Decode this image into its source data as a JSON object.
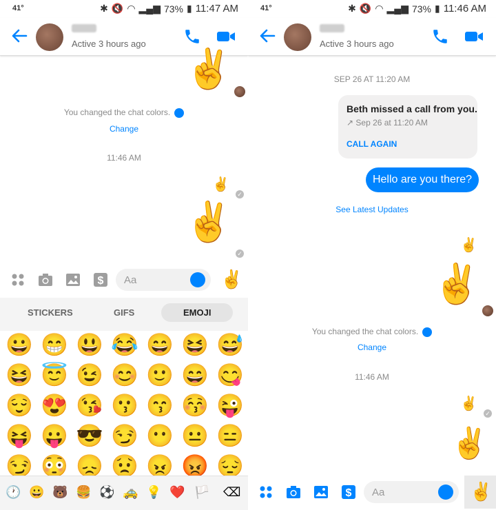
{
  "left": {
    "status": {
      "indicator": "41°",
      "battery": "73%",
      "time": "11:47 AM"
    },
    "header": {
      "active": "Active 3 hours ago"
    },
    "notice": "You changed the chat colors.",
    "change_link": "Change",
    "timestamp": "11:46 AM",
    "composer": {
      "placeholder": "Aa"
    },
    "tabs": [
      "STICKERS",
      "GIFS",
      "EMOJI"
    ],
    "emoji_rows": [
      [
        "😀",
        "😁",
        "😃",
        "😂",
        "😄",
        "😆",
        "😅"
      ],
      [
        "😆",
        "😇",
        "😉",
        "😊",
        "🙂",
        "😄",
        "😋"
      ],
      [
        "😌",
        "😍",
        "😘",
        "😗",
        "😙",
        "😚",
        "😜"
      ],
      [
        "😝",
        "😛",
        "😎",
        "😏",
        "😶",
        "😐",
        "😑"
      ],
      [
        "😏",
        "😳",
        "😞",
        "😟",
        "😠",
        "😡",
        "😔"
      ]
    ],
    "categories": [
      "🕐",
      "😀",
      "🐻",
      "🍔",
      "⚽",
      "🚕",
      "💡",
      "❤️",
      "🏳️",
      "⌫"
    ]
  },
  "right": {
    "status": {
      "indicator": "41°",
      "battery": "73%",
      "time": "11:46 AM"
    },
    "header": {
      "active": "Active 3 hours ago"
    },
    "date_stamp": "SEP 26 AT 11:20 AM",
    "missed_call": {
      "title": "Beth missed a call from you.",
      "sub": "↗ Sep 26 at 11:20 AM",
      "action": "CALL AGAIN"
    },
    "message": "Hello are you there?",
    "updates_link": "See Latest Updates",
    "notice": "You changed the chat colors.",
    "change_link": "Change",
    "timestamp": "11:46 AM",
    "composer": {
      "placeholder": "Aa"
    }
  },
  "peace": "✌️",
  "colors": {
    "accent": "#0084ff",
    "muted": "#8a8a8a"
  }
}
